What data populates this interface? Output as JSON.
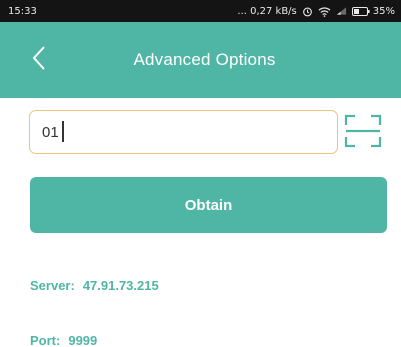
{
  "status_bar": {
    "time": "15:33",
    "network_speed": "... 0,27 kB/s",
    "battery": "35%"
  },
  "header": {
    "title": "Advanced Options",
    "back_icon": "chevron-left-icon"
  },
  "device_input": {
    "value": "01",
    "scan_icon": "scan-frame-icon"
  },
  "obtain_button": {
    "label": "Obtain"
  },
  "info": {
    "server_label": "Server:",
    "server_value": "47.91.73.215",
    "port_label": "Port:",
    "port_value": "9999"
  },
  "colors": {
    "accent": "#4fb6a6",
    "input_border": "#f0c27a",
    "status_bar": "#141414"
  }
}
